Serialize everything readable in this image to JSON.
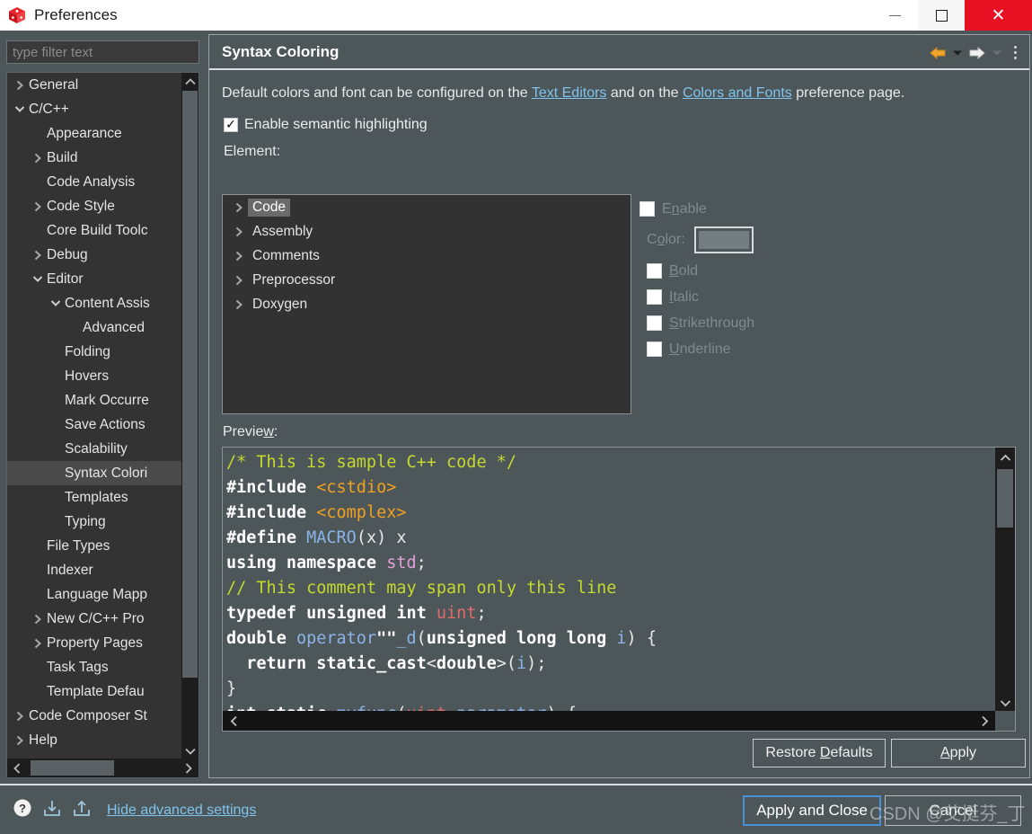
{
  "window": {
    "title": "Preferences",
    "icon": "eclipse-cube-icon",
    "controls": {
      "minimize": "minimize-icon",
      "maximize": "maximize-icon",
      "close": "close-icon"
    }
  },
  "sidebar": {
    "filter_placeholder": "type filter text",
    "items": [
      {
        "label": "General",
        "indent": 0,
        "twisty": "collapsed",
        "selected": false
      },
      {
        "label": "C/C++",
        "indent": 0,
        "twisty": "expanded",
        "selected": false
      },
      {
        "label": "Appearance",
        "indent": 1,
        "twisty": "none",
        "selected": false
      },
      {
        "label": "Build",
        "indent": 1,
        "twisty": "collapsed",
        "selected": false
      },
      {
        "label": "Code Analysis",
        "indent": 1,
        "twisty": "none",
        "selected": false
      },
      {
        "label": "Code Style",
        "indent": 1,
        "twisty": "collapsed",
        "selected": false
      },
      {
        "label": "Core Build Toolc",
        "indent": 1,
        "twisty": "none",
        "selected": false
      },
      {
        "label": "Debug",
        "indent": 1,
        "twisty": "collapsed",
        "selected": false
      },
      {
        "label": "Editor",
        "indent": 1,
        "twisty": "expanded",
        "selected": false
      },
      {
        "label": "Content Assis",
        "indent": 2,
        "twisty": "expanded",
        "selected": false
      },
      {
        "label": "Advanced",
        "indent": 3,
        "twisty": "none",
        "selected": false
      },
      {
        "label": "Folding",
        "indent": 2,
        "twisty": "none",
        "selected": false
      },
      {
        "label": "Hovers",
        "indent": 2,
        "twisty": "none",
        "selected": false
      },
      {
        "label": "Mark Occurre",
        "indent": 2,
        "twisty": "none",
        "selected": false
      },
      {
        "label": "Save Actions",
        "indent": 2,
        "twisty": "none",
        "selected": false
      },
      {
        "label": "Scalability",
        "indent": 2,
        "twisty": "none",
        "selected": false
      },
      {
        "label": "Syntax Colori",
        "indent": 2,
        "twisty": "none",
        "selected": true
      },
      {
        "label": "Templates",
        "indent": 2,
        "twisty": "none",
        "selected": false
      },
      {
        "label": "Typing",
        "indent": 2,
        "twisty": "none",
        "selected": false
      },
      {
        "label": "File Types",
        "indent": 1,
        "twisty": "none",
        "selected": false
      },
      {
        "label": "Indexer",
        "indent": 1,
        "twisty": "none",
        "selected": false
      },
      {
        "label": "Language Mapp",
        "indent": 1,
        "twisty": "none",
        "selected": false
      },
      {
        "label": "New C/C++ Pro",
        "indent": 1,
        "twisty": "collapsed",
        "selected": false
      },
      {
        "label": "Property Pages",
        "indent": 1,
        "twisty": "collapsed",
        "selected": false
      },
      {
        "label": "Task Tags",
        "indent": 1,
        "twisty": "none",
        "selected": false
      },
      {
        "label": "Template Defau",
        "indent": 1,
        "twisty": "none",
        "selected": false
      },
      {
        "label": "Code Composer St",
        "indent": 0,
        "twisty": "collapsed",
        "selected": false
      },
      {
        "label": "Help",
        "indent": 0,
        "twisty": "collapsed",
        "selected": false
      }
    ]
  },
  "page": {
    "title": "Syntax Coloring",
    "toolbar": {
      "back": "back-arrow-icon",
      "back_menu": "chevron-down-icon",
      "forward": "forward-arrow-icon",
      "forward_menu": "chevron-down-icon",
      "menu": "kebab-menu-icon"
    },
    "description": {
      "part1": "Default colors and font can be configured on the ",
      "link1": "Text Editors",
      "part2": " and on the ",
      "link2": "Colors and Fonts",
      "part3": " preference page."
    },
    "enable_semantic": {
      "label": "Enable semantic highlighting",
      "checked": true
    },
    "element_label": "Element:",
    "elements": [
      {
        "label": "Code",
        "selected": true
      },
      {
        "label": "Assembly",
        "selected": false
      },
      {
        "label": "Comments",
        "selected": false
      },
      {
        "label": "Preprocessor",
        "selected": false
      },
      {
        "label": "Doxygen",
        "selected": false
      }
    ],
    "style": {
      "enable": {
        "label": "Enable",
        "checked": false,
        "disabled": true,
        "mnemonic": "b"
      },
      "color_label": "Color:",
      "color_value": "#747e80",
      "bold": {
        "label": "Bold",
        "checked": false,
        "disabled": true,
        "mnemonic": "B"
      },
      "italic": {
        "label": "Italic",
        "checked": false,
        "disabled": true,
        "mnemonic": "I"
      },
      "strikethrough": {
        "label": "Strikethrough",
        "checked": false,
        "disabled": true,
        "mnemonic": "S"
      },
      "underline": {
        "label": "Underline",
        "checked": false,
        "disabled": true,
        "mnemonic": "U"
      }
    },
    "preview_label": "Preview:",
    "preview_code": [
      [
        {
          "t": "/* This is sample C++ code */",
          "c": "c-comment"
        }
      ],
      [
        {
          "t": "#include ",
          "c": "c-kw"
        },
        {
          "t": "<cstdio>",
          "c": "c-inc"
        }
      ],
      [
        {
          "t": "#include ",
          "c": "c-kw"
        },
        {
          "t": "<complex>",
          "c": "c-inc"
        }
      ],
      [
        {
          "t": "#define ",
          "c": "c-kw"
        },
        {
          "t": "MACRO",
          "c": "c-macro"
        },
        {
          "t": "(x) x",
          "c": "c-plain"
        }
      ],
      [
        {
          "t": "using namespace ",
          "c": "c-kw"
        },
        {
          "t": "std",
          "c": "c-ns"
        },
        {
          "t": ";",
          "c": "c-plain"
        }
      ],
      [
        {
          "t": "// This comment may span only this line",
          "c": "c-comment"
        }
      ],
      [
        {
          "t": "typedef unsigned int ",
          "c": "c-kw"
        },
        {
          "t": "uint",
          "c": "c-type"
        },
        {
          "t": ";",
          "c": "c-plain"
        }
      ],
      [
        {
          "t": "double ",
          "c": "c-kw"
        },
        {
          "t": "operator",
          "c": "c-fn"
        },
        {
          "t": "\"\"",
          "c": "c-kw"
        },
        {
          "t": "_d",
          "c": "c-fn"
        },
        {
          "t": "(",
          "c": "c-plain"
        },
        {
          "t": "unsigned long long ",
          "c": "c-kw"
        },
        {
          "t": "i",
          "c": "c-var"
        },
        {
          "t": ") {",
          "c": "c-plain"
        }
      ],
      [
        {
          "t": "  return static_cast",
          "c": "c-kw"
        },
        {
          "t": "<",
          "c": "c-plain"
        },
        {
          "t": "double",
          "c": "c-kw"
        },
        {
          "t": ">(",
          "c": "c-plain"
        },
        {
          "t": "i",
          "c": "c-var"
        },
        {
          "t": ");",
          "c": "c-plain"
        }
      ],
      [
        {
          "t": "}",
          "c": "c-plain"
        }
      ],
      [
        {
          "t": "int static ",
          "c": "c-kw"
        },
        {
          "t": "myfunc",
          "c": "c-fn"
        },
        {
          "t": "(",
          "c": "c-plain"
        },
        {
          "t": "uint",
          "c": "c-type"
        },
        {
          "t": " parameter",
          "c": "c-var"
        },
        {
          "t": ") {",
          "c": "c-plain"
        }
      ]
    ],
    "restore_defaults": {
      "pre": "Restore ",
      "mnemonic": "D",
      "post": "efaults"
    },
    "apply": {
      "mnemonic": "A",
      "post": "pply"
    }
  },
  "footer": {
    "help_icon": "help-icon",
    "import_icon": "import-icon",
    "export_icon": "export-icon",
    "hide_advanced": "Hide advanced settings",
    "apply_and_close": "Apply and Close",
    "cancel": "Cancel",
    "watermark": "CSDN @艾挺芬_丁"
  }
}
